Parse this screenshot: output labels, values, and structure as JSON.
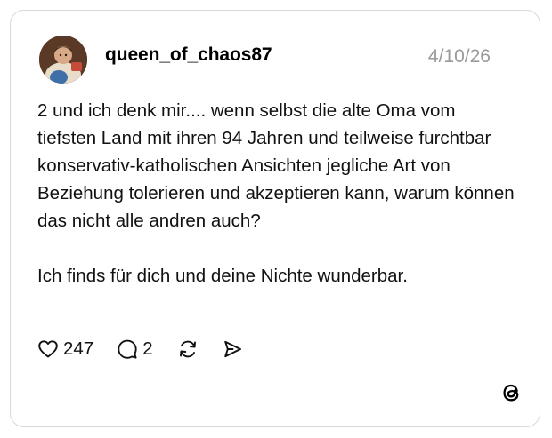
{
  "post": {
    "username": "queen_of_chaos87",
    "date": "4/10/26",
    "paragraphs": [
      "2 und ich denk mir.... wenn selbst die alte Oma vom tiefsten Land mit ihren 94 Jahren und teilweise furchtbar konservativ-katholischen Ansichten jegliche Art von Beziehung tolerieren und akzeptieren kann, warum können das nicht alle andren auch?",
      "Ich finds für dich und deine Nichte wunderbar."
    ],
    "likes": "247",
    "replies": "2"
  },
  "icons": {
    "like": "heart-icon",
    "reply": "comment-bubble-icon",
    "repost": "repost-icon",
    "share": "send-icon",
    "brand": "threads-logo-icon"
  },
  "colors": {
    "text": "#111111",
    "muted": "#999999",
    "border": "#d9d9d9"
  }
}
